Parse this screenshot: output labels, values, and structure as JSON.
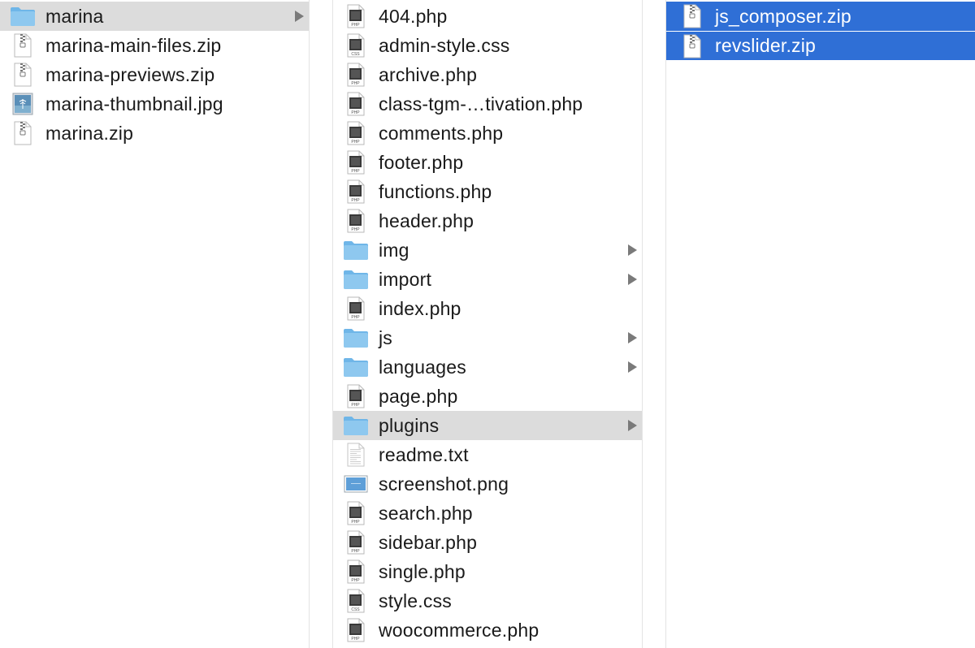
{
  "columns": [
    {
      "items": [
        {
          "name": "marina",
          "kind": "folder",
          "has_children": true,
          "state": "gray"
        },
        {
          "name": "marina-main-files.zip",
          "kind": "zip"
        },
        {
          "name": "marina-previews.zip",
          "kind": "zip"
        },
        {
          "name": "marina-thumbnail.jpg",
          "kind": "jpg"
        },
        {
          "name": "marina.zip",
          "kind": "zip"
        }
      ]
    },
    {
      "items": [
        {
          "name": "404.php",
          "kind": "php"
        },
        {
          "name": "admin-style.css",
          "kind": "css"
        },
        {
          "name": "archive.php",
          "kind": "php"
        },
        {
          "name": "class-tgm-…tivation.php",
          "kind": "php"
        },
        {
          "name": "comments.php",
          "kind": "php"
        },
        {
          "name": "footer.php",
          "kind": "php"
        },
        {
          "name": "functions.php",
          "kind": "php"
        },
        {
          "name": "header.php",
          "kind": "php"
        },
        {
          "name": "img",
          "kind": "folder",
          "has_children": true
        },
        {
          "name": "import",
          "kind": "folder",
          "has_children": true
        },
        {
          "name": "index.php",
          "kind": "php"
        },
        {
          "name": "js",
          "kind": "folder",
          "has_children": true
        },
        {
          "name": "languages",
          "kind": "folder",
          "has_children": true
        },
        {
          "name": "page.php",
          "kind": "php"
        },
        {
          "name": "plugins",
          "kind": "folder",
          "has_children": true,
          "state": "gray"
        },
        {
          "name": "readme.txt",
          "kind": "txt"
        },
        {
          "name": "screenshot.png",
          "kind": "png"
        },
        {
          "name": "search.php",
          "kind": "php"
        },
        {
          "name": "sidebar.php",
          "kind": "php"
        },
        {
          "name": "single.php",
          "kind": "php"
        },
        {
          "name": "style.css",
          "kind": "css"
        },
        {
          "name": "woocommerce.php",
          "kind": "php"
        }
      ]
    },
    {
      "items": [
        {
          "name": "js_composer.zip",
          "kind": "zip",
          "state": "blue"
        },
        {
          "name": "revslider.zip",
          "kind": "zip",
          "state": "blue"
        }
      ]
    }
  ],
  "icons": {
    "folder": "folder-icon",
    "zip": "zip-archive-icon",
    "php": "php-file-icon",
    "css": "css-file-icon",
    "txt": "text-file-icon",
    "jpg": "image-thumbnail-icon",
    "png": "image-thumbnail-icon",
    "chevron": "chevron-right-icon"
  },
  "icon_text": {
    "php": "PHP",
    "css": "CSS"
  },
  "colors": {
    "selection_blue": "#2f6fd6",
    "selection_gray": "#dcdcdc",
    "folder_blue": "#8ec8ef",
    "chevron": "#7a7a7a"
  }
}
